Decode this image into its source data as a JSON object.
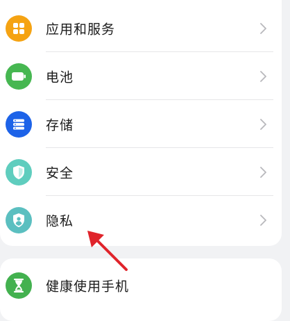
{
  "settings_list": {
    "items": [
      {
        "label": "应用和服务",
        "icon": "apps-icon",
        "color": "#F5A313"
      },
      {
        "label": "电池",
        "icon": "battery-icon",
        "color": "#46B751"
      },
      {
        "label": "存储",
        "icon": "storage-icon",
        "color": "#1D63E8"
      },
      {
        "label": "安全",
        "icon": "security-shield-icon",
        "color": "#5FCDBE"
      },
      {
        "label": "隐私",
        "icon": "privacy-shield-icon",
        "color": "#5BBFC0"
      }
    ]
  },
  "settings_list_2": {
    "items": [
      {
        "label": "健康使用手机",
        "icon": "hourglass-icon",
        "color": "#43B14F"
      }
    ]
  },
  "annotation": {
    "arrow_color": "#E0242B"
  }
}
